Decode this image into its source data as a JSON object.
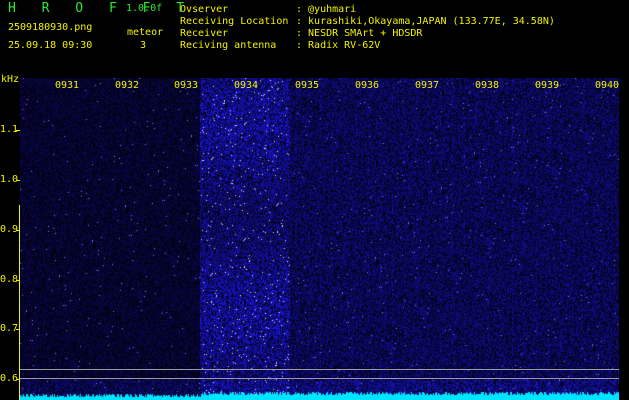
{
  "header": {
    "app_title": "H R O F F T",
    "app_version": "1.0.0f",
    "file_name": "2509180930.png",
    "meteor_label": "meteor",
    "date_time": "25.09.18 09:30",
    "meteor_count": "3"
  },
  "info": [
    {
      "key": "Ovserver",
      "value": ": @yuhmari"
    },
    {
      "key": "Receiving Location",
      "value": ": kurashiki,Okayama,JAPAN (133.77E, 34.58N)"
    },
    {
      "key": "Receiver",
      "value": ": NESDR SMArt + HDSDR"
    },
    {
      "key": "Reciving antenna",
      "value": ": Radix RV-62V"
    }
  ],
  "plot": {
    "unit": "kHz",
    "time_ticks": [
      "0931",
      "0932",
      "0933",
      "0934",
      "0935",
      "0936",
      "0937",
      "0938",
      "0939",
      "0940"
    ],
    "freq_ticks": [
      "1.1",
      "1.0",
      "0.9",
      "0.8",
      "0.7",
      "0.6"
    ],
    "colors": {
      "background": "#000000",
      "noise": "#1a1ad8",
      "bright": "#ffffff",
      "baseline": "#00e5ff"
    }
  }
}
